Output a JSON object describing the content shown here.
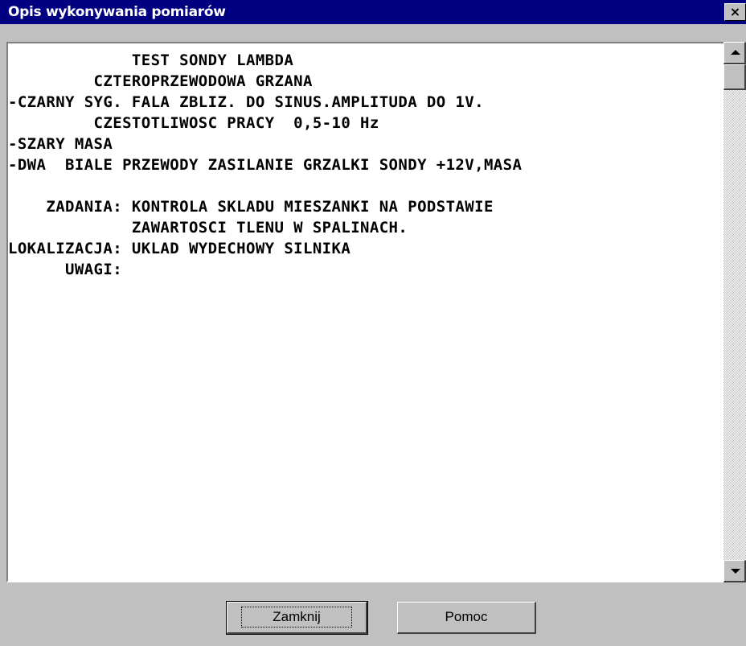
{
  "window": {
    "title": "Opis wykonywania pomiarów",
    "close_symbol": "×"
  },
  "description": {
    "lines": [
      "             TEST SONDY LAMBDA",
      "         CZTEROPRZEWODOWA GRZANA",
      "-CZARNY SYG. FALA ZBLIZ. DO SINUS.AMPLITUDA DO 1V.",
      "         CZESTOTLIWOSC PRACY  0,5-10 Hz",
      "-SZARY MASA",
      "-DWA  BIALE PRZEWODY ZASILANIE GRZALKI SONDY +12V,MASA",
      "",
      "    ZADANIA: KONTROLA SKLADU MIESZANKI NA PODSTAWIE",
      "             ZAWARTOSCI TLENU W SPALINACH.",
      "LOKALIZACJA: UKLAD WYDECHOWY SILNIKA",
      "      UWAGI:"
    ]
  },
  "buttons": {
    "close_label": "Zamknij",
    "help_label": "Pomoc"
  }
}
